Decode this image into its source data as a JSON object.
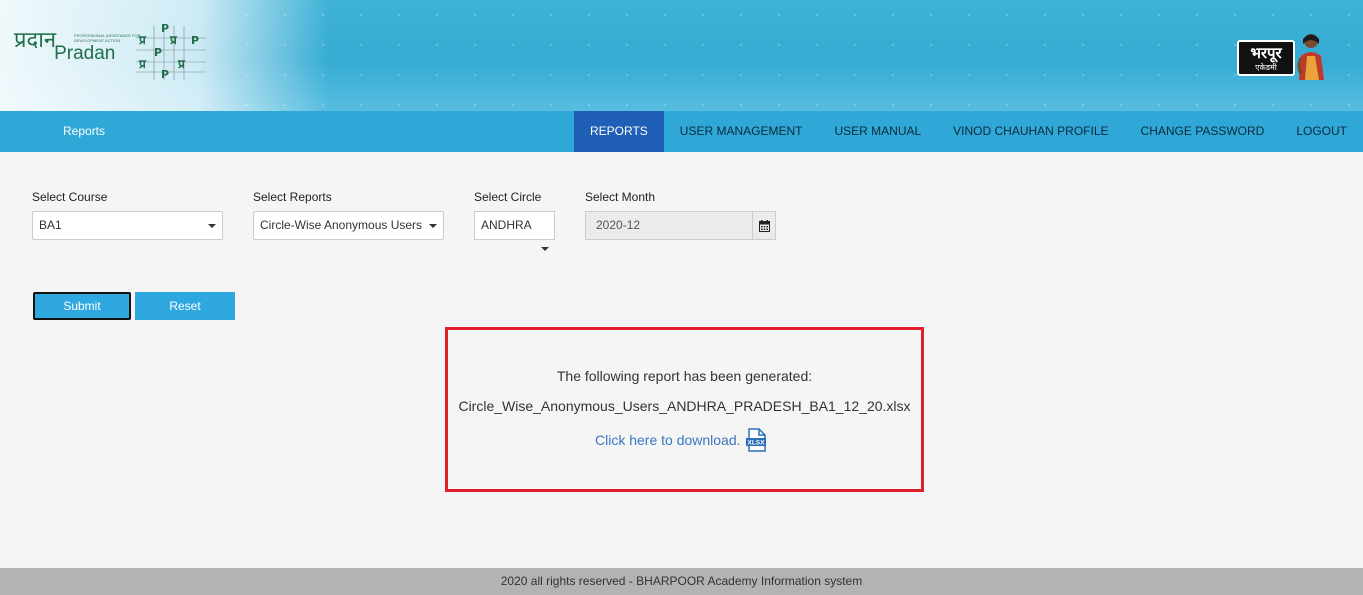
{
  "header": {
    "pradan_hindi": "प्रदान",
    "pradan_name": "Pradan",
    "pradan_tagline": "PROFESSIONAL ASSISTANCE FOR DEVELOPMENT ACTION",
    "bharpoor_hindi": "भरपूर",
    "bharpoor_sub": "एकेडमी"
  },
  "nav": {
    "brand": "Reports",
    "items": [
      {
        "label": "REPORTS",
        "active": true
      },
      {
        "label": "USER MANAGEMENT"
      },
      {
        "label": "USER MANUAL"
      },
      {
        "label": "VINOD CHAUHAN PROFILE"
      },
      {
        "label": "CHANGE PASSWORD"
      },
      {
        "label": "LOGOUT"
      }
    ]
  },
  "form": {
    "course_label": "Select Course",
    "course_value": "BA1",
    "reports_label": "Select Reports",
    "reports_value": "Circle-Wise Anonymous Users",
    "circle_label": "Select Circle",
    "circle_value": "ANDHRA",
    "month_label": "Select Month",
    "month_value": "2020-12",
    "submit_label": "Submit",
    "reset_label": "Reset"
  },
  "result": {
    "message": "The following report has been generated:",
    "filename": "Circle_Wise_Anonymous_Users_ANDHRA_PRADESH_BA1_12_20.xlsx",
    "download_label": "Click here to download.",
    "file_icon_text": "XLSX"
  },
  "footer": {
    "text": "2020 all rights reserved - BHARPOOR Academy Information system"
  },
  "colors": {
    "nav_bg": "#2fa8d8",
    "nav_active": "#1f5fb5",
    "button": "#2fa8e0",
    "highlight_border": "#e0202c",
    "link": "#3a77c0"
  }
}
